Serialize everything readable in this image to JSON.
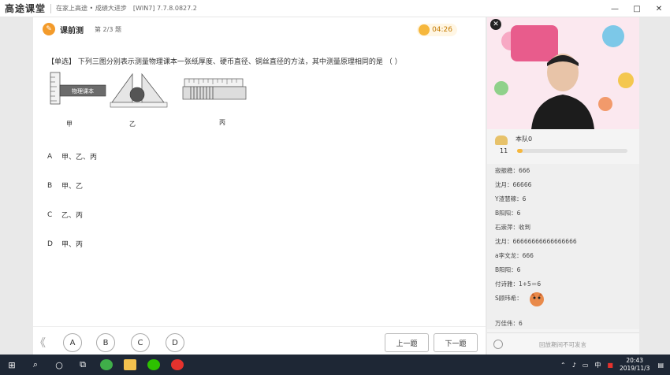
{
  "titlebar": {
    "logo": "高途课堂",
    "slogan": "在家上高途 • 成绩大进步",
    "version": "[WIN7] 7.7.8.0827.2",
    "controls": [
      "—",
      "□",
      "✕"
    ]
  },
  "quiz_header": {
    "title": "课前测",
    "counter": "第 2/3 题",
    "timer": "04:26"
  },
  "question": {
    "text": "【单选】 下列三图分别表示测量物理课本一张纸厚度、硬币直径、铜丝直径的方法，其中测量原理相同的是 （ ）",
    "figure_text": "物理课本",
    "figure_labels": [
      "甲",
      "乙",
      "丙"
    ]
  },
  "options": [
    {
      "letter": "A",
      "text": "甲、乙、丙"
    },
    {
      "letter": "B",
      "text": "甲、乙"
    },
    {
      "letter": "C",
      "text": "乙、丙"
    },
    {
      "letter": "D",
      "text": "甲、丙"
    }
  ],
  "answer_choices": [
    "A",
    "B",
    "C",
    "D"
  ],
  "nav": {
    "collapse": "《",
    "prev": "上一题",
    "next": "下一题"
  },
  "team": {
    "name": "本队0",
    "count": "11",
    "progress": 0.05
  },
  "chat": {
    "messages": [
      "寂振稳：666",
      "沈月：66666",
      "Y渣慧稼：6",
      "B阳阳：6",
      "石崇萍：收到",
      "沈月：66666666666666666",
      "a李文龙：666",
      "B阳阳：6",
      "付诗雅：1+5＝6",
      "S顾玮希：",
      "万佳伟：6"
    ],
    "input_placeholder": "回放期间不可发言"
  },
  "taskbar": {
    "ime": "中",
    "time": "20:43",
    "date": "2019/11/3"
  },
  "colors": {
    "accent_orange": "#f39b2b",
    "timer_bg": "#fff6e4",
    "taskbar": "#1e2735"
  }
}
